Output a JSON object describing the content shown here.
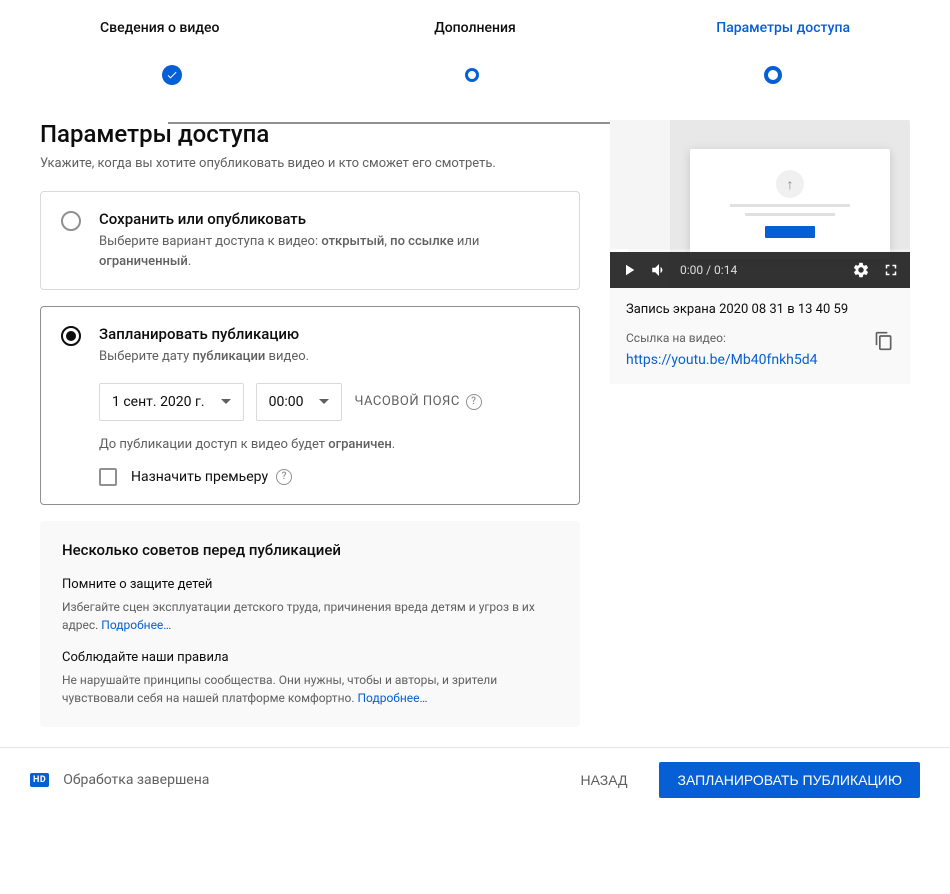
{
  "stepper": {
    "step1": "Сведения о видео",
    "step2": "Дополнения",
    "step3": "Параметры доступа"
  },
  "page": {
    "title": "Параметры доступа",
    "subtitle": "Укажите, когда вы хотите опубликовать видео и кто сможет его смотреть."
  },
  "option_save": {
    "title": "Сохранить или опубликовать",
    "desc_prefix": "Выберите вариант доступа к видео: ",
    "b1": "открытый",
    "sep1": ", ",
    "b2": "по ссылке",
    "sep2": " или ",
    "b3": "ограниченный",
    "suffix": "."
  },
  "option_schedule": {
    "title": "Запланировать публикацию",
    "desc_prefix": "Выберите дату ",
    "b1": "публикации",
    "suffix": " видео.",
    "date": "1 сент. 2020 г.",
    "time": "00:00",
    "timezone": "ЧАСОВОЙ ПОЯС",
    "note_prefix": "До публикации доступ к видео будет ",
    "note_b": "ограничен",
    "note_suffix": ".",
    "premiere": "Назначить премьеру"
  },
  "tips": {
    "title": "Несколько советов перед публикацией",
    "tip1_head": "Помните о защите детей",
    "tip1_body": "Избегайте сцен эксплуатации детского труда, причинения вреда детям и угроз в их адрес. ",
    "tip1_link": "Подробнее…",
    "tip2_head": "Соблюдайте наши правила",
    "tip2_body": "Не нарушайте принципы сообщества. Они нужны, чтобы и авторы, и зрители чувствовали себя на нашей платформе комфортно. ",
    "tip2_link": "Подробнее…"
  },
  "preview": {
    "time": "0:00 / 0:14",
    "title": "Запись экрана 2020 08 31 в 13 40 59",
    "link_label": "Ссылка на видео:",
    "link": "https://youtu.be/Mb40fnkh5d4"
  },
  "footer": {
    "hd": "HD",
    "status": "Обработка завершена",
    "back": "НАЗАД",
    "submit": "ЗАПЛАНИРОВАТЬ ПУБЛИКАЦИЮ"
  }
}
